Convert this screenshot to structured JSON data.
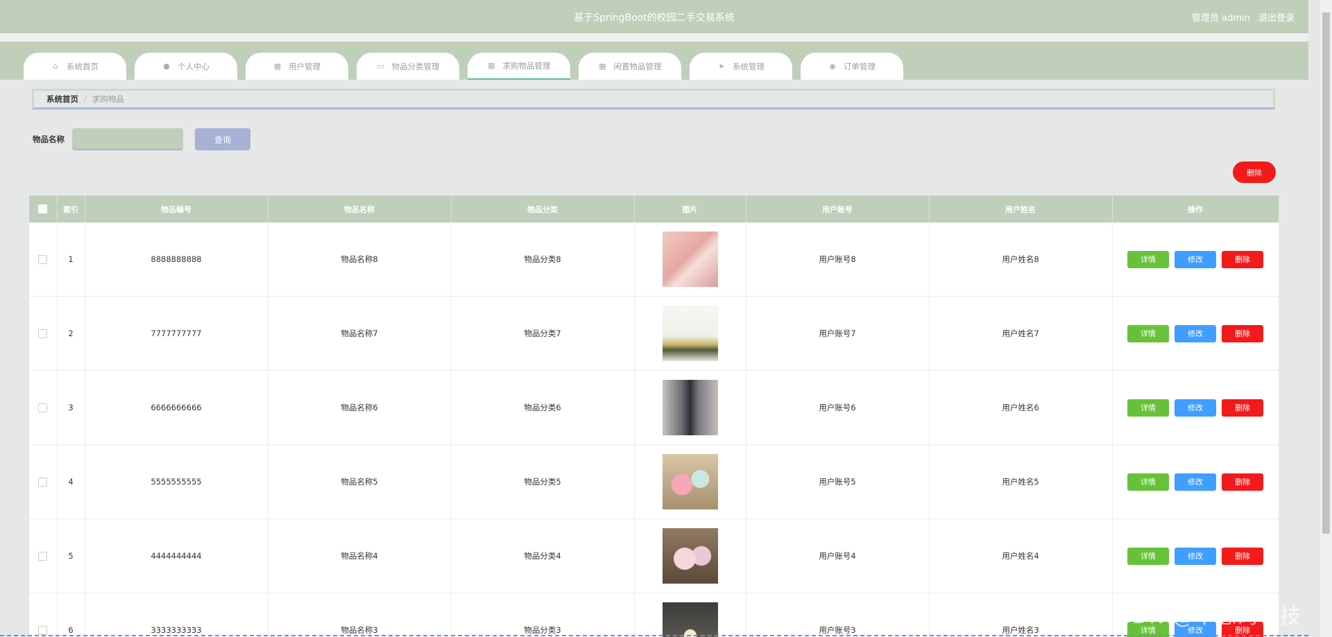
{
  "header": {
    "title": "基于SpringBoot的校园二手交易系统",
    "user_label": "管理员 admin",
    "logout_label": "退出登录"
  },
  "nav": {
    "tabs": [
      {
        "label": "系统首页",
        "icon": "home-icon"
      },
      {
        "label": "个人中心",
        "icon": "user-icon"
      },
      {
        "label": "用户管理",
        "icon": "grid-icon"
      },
      {
        "label": "物品分类管理",
        "icon": "briefcase-icon"
      },
      {
        "label": "求购物品管理",
        "icon": "grid-icon",
        "active": true
      },
      {
        "label": "闲置物品管理",
        "icon": "grid-icon"
      },
      {
        "label": "系统管理",
        "icon": "send-icon"
      },
      {
        "label": "订单管理",
        "icon": "pin-icon"
      }
    ]
  },
  "breadcrumb": {
    "home": "系统首页",
    "separator": "/",
    "current": "求购物品"
  },
  "search": {
    "label": "物品名称",
    "value": "",
    "placeholder": "",
    "button_label": "查询"
  },
  "toolbar": {
    "batch_delete_label": "删除"
  },
  "table": {
    "columns": [
      "索引",
      "物品编号",
      "物品名称",
      "物品分类",
      "图片",
      "用户账号",
      "用户姓名",
      "操作"
    ],
    "rows": [
      {
        "index": "1",
        "code": "8888888888",
        "name": "物品名称8",
        "category": "物品分类8",
        "account": "用户账号8",
        "username": "用户姓名8"
      },
      {
        "index": "2",
        "code": "7777777777",
        "name": "物品名称7",
        "category": "物品分类7",
        "account": "用户账号7",
        "username": "用户姓名7"
      },
      {
        "index": "3",
        "code": "6666666666",
        "name": "物品名称6",
        "category": "物品分类6",
        "account": "用户账号6",
        "username": "用户姓名6"
      },
      {
        "index": "4",
        "code": "5555555555",
        "name": "物品名称5",
        "category": "物品分类5",
        "account": "用户账号5",
        "username": "用户姓名5"
      },
      {
        "index": "5",
        "code": "4444444444",
        "name": "物品名称4",
        "category": "物品分类4",
        "account": "用户账号4",
        "username": "用户姓名4"
      },
      {
        "index": "6",
        "code": "3333333333",
        "name": "物品名称3",
        "category": "物品分类3",
        "account": "用户账号3",
        "username": "用户姓名3"
      }
    ],
    "actions": {
      "detail": "详情",
      "edit": "修改",
      "delete": "删除"
    }
  },
  "watermark": "CSDN @千思码科技",
  "colors": {
    "header_bg": "#bfcfba",
    "page_bg": "#e6e8e8",
    "detail_btn": "#67c23a",
    "edit_btn": "#409eff",
    "delete_btn": "#f21a1a",
    "search_btn": "#a7b1d6"
  }
}
